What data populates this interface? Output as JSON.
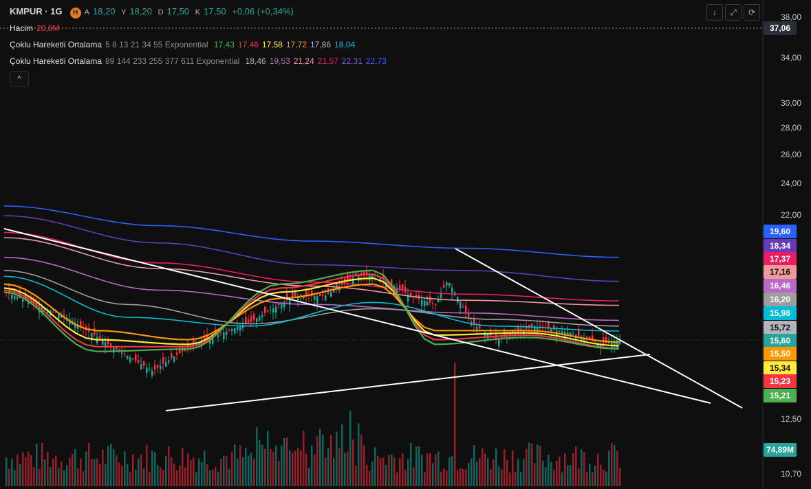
{
  "header": {
    "symbol": "KMPUR · 1G",
    "badge": "H",
    "open_label": "A",
    "open": "18,20",
    "high_label": "Y",
    "high": "18,20",
    "low_label": "D",
    "low": "17,50",
    "close_label": "K",
    "close": "17,50",
    "change": "+0,06 (+0,34%)"
  },
  "volume_legend": {
    "label": "Hacim",
    "value": "20,8M"
  },
  "ma_legend_1": {
    "name": "Çoklu Hareketli Ortalama",
    "params": "5 8 13 21 34 55 Exponential",
    "values": [
      {
        "v": "17,43",
        "color": "#4caf50"
      },
      {
        "v": "17,46",
        "color": "#f23645"
      },
      {
        "v": "17,58",
        "color": "#ffeb3b"
      },
      {
        "v": "17,72",
        "color": "#ff9800"
      },
      {
        "v": "17,86",
        "color": "#b2b5be"
      },
      {
        "v": "18,04",
        "color": "#00bcd4"
      }
    ]
  },
  "ma_legend_2": {
    "name": "Çoklu Hareketli Ortalama",
    "params": "89 144 233 255 377 611 Exponential",
    "values": [
      {
        "v": "18,46",
        "color": "#b2b5be"
      },
      {
        "v": "19,53",
        "color": "#ba68c8"
      },
      {
        "v": "21,24",
        "color": "#ef9a9a"
      },
      {
        "v": "21,57",
        "color": "#e91e63"
      },
      {
        "v": "22,31",
        "color": "#7e57c2"
      },
      {
        "v": "22,73",
        "color": "#2962ff"
      }
    ]
  },
  "toolbar": {
    "collapse": "^",
    "btn_down": "↓",
    "btn_expand": "⤢",
    "btn_refresh": "⟳"
  },
  "price_axis": {
    "ticks": [
      "38,00",
      "34,00",
      "30,00",
      "28,00",
      "26,00",
      "24,00",
      "22,00",
      "12,50",
      "10,70"
    ],
    "crosshair_value": "37,06",
    "ma_tags": [
      {
        "v": "19,60",
        "color": "#2962ff"
      },
      {
        "v": "18,34",
        "color": "#673ab7"
      },
      {
        "v": "17,37",
        "color": "#e91e63"
      },
      {
        "v": "17,16",
        "color": "#ef9a9a"
      },
      {
        "v": "16,46",
        "color": "#ba68c8"
      },
      {
        "v": "16,20",
        "color": "#9e9e9e"
      },
      {
        "v": "15,98",
        "color": "#00bcd4"
      },
      {
        "v": "15,72",
        "color": "#b2b5be"
      },
      {
        "v": "15,60",
        "color": "#26a69a"
      },
      {
        "v": "15,50",
        "color": "#ff9800"
      },
      {
        "v": "15,34",
        "color": "#ffeb3b"
      },
      {
        "v": "15,23",
        "color": "#f23645"
      },
      {
        "v": "15,21",
        "color": "#4caf50"
      }
    ],
    "volume_tag": {
      "v": "74,89M",
      "color": "#26a69a"
    }
  },
  "chart_data": {
    "type": "line",
    "y_axis_scale": "log",
    "ylim": [
      10.7,
      38.0
    ],
    "series": [
      {
        "color": "#2962ff",
        "x": [
          0,
          0.25,
          0.5,
          0.75,
          1
        ],
        "y": [
          22.6,
          21.4,
          20.5,
          20.1,
          19.6
        ]
      },
      {
        "color": "#673ab7",
        "x": [
          0,
          0.25,
          0.5,
          0.75,
          1
        ],
        "y": [
          22.0,
          20.4,
          19.2,
          18.9,
          18.34
        ]
      },
      {
        "color": "#e91e63",
        "x": [
          0,
          0.25,
          0.5,
          0.75,
          1
        ],
        "y": [
          21.0,
          19.3,
          18.3,
          17.7,
          17.37
        ]
      },
      {
        "color": "#ef9a9a",
        "x": [
          0,
          0.25,
          0.5,
          0.75,
          1
        ],
        "y": [
          20.7,
          19.0,
          18.1,
          17.4,
          17.16
        ]
      },
      {
        "color": "#ba68c8",
        "x": [
          0,
          0.25,
          0.5,
          0.75,
          1
        ],
        "y": [
          19.6,
          17.9,
          17.2,
          16.8,
          16.46
        ]
      },
      {
        "color": "#9e9e9e",
        "x": [
          0,
          0.2,
          0.4,
          0.6,
          0.8,
          1
        ],
        "y": [
          18.9,
          17.2,
          16.3,
          17.0,
          16.5,
          16.2
        ]
      },
      {
        "color": "#00bcd4",
        "x": [
          0,
          0.2,
          0.4,
          0.6,
          0.8,
          1
        ],
        "y": [
          18.6,
          16.6,
          16.2,
          17.3,
          16.2,
          15.98
        ]
      },
      {
        "color": "#ff9800",
        "x": [
          0,
          0.15,
          0.3,
          0.45,
          0.6,
          0.7,
          0.85,
          1
        ],
        "y": [
          18.2,
          16.0,
          15.6,
          17.5,
          18.2,
          16.0,
          16.0,
          15.5
        ]
      },
      {
        "color": "#ffeb3b",
        "x": [
          0,
          0.15,
          0.3,
          0.45,
          0.6,
          0.7,
          0.85,
          1
        ],
        "y": [
          18.0,
          15.6,
          15.4,
          17.8,
          18.5,
          15.8,
          15.9,
          15.34
        ]
      },
      {
        "color": "#f23645",
        "x": [
          0,
          0.15,
          0.3,
          0.45,
          0.6,
          0.7,
          0.85,
          1
        ],
        "y": [
          17.9,
          15.3,
          15.3,
          18.0,
          18.7,
          15.6,
          15.8,
          15.23
        ]
      },
      {
        "color": "#4caf50",
        "x": [
          0,
          0.15,
          0.3,
          0.45,
          0.6,
          0.7,
          0.85,
          1
        ],
        "y": [
          17.8,
          15.1,
          15.2,
          18.2,
          18.9,
          15.4,
          15.7,
          15.21
        ]
      }
    ]
  }
}
